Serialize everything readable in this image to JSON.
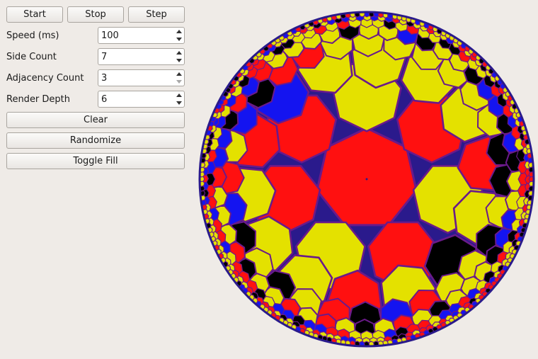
{
  "toolbar": {
    "start_label": "Start",
    "stop_label": "Stop",
    "step_label": "Step"
  },
  "fields": {
    "speed": {
      "label": "Speed (ms)",
      "value": "100"
    },
    "side_count": {
      "label": "Side Count",
      "value": "7"
    },
    "adjacency_count": {
      "label": "Adjacency Count",
      "value": "3"
    },
    "render_depth": {
      "label": "Render Depth",
      "value": "6"
    }
  },
  "actions": {
    "clear_label": "Clear",
    "randomize_label": "Randomize",
    "toggle_fill_label": "Toggle Fill"
  },
  "tiling": {
    "colors": {
      "yellow": "#e4e100",
      "red": "#ff1010",
      "blue": "#1414f0",
      "black": "#000000",
      "edge": "#6a1a8a",
      "rim": "#2a1a8c"
    }
  }
}
